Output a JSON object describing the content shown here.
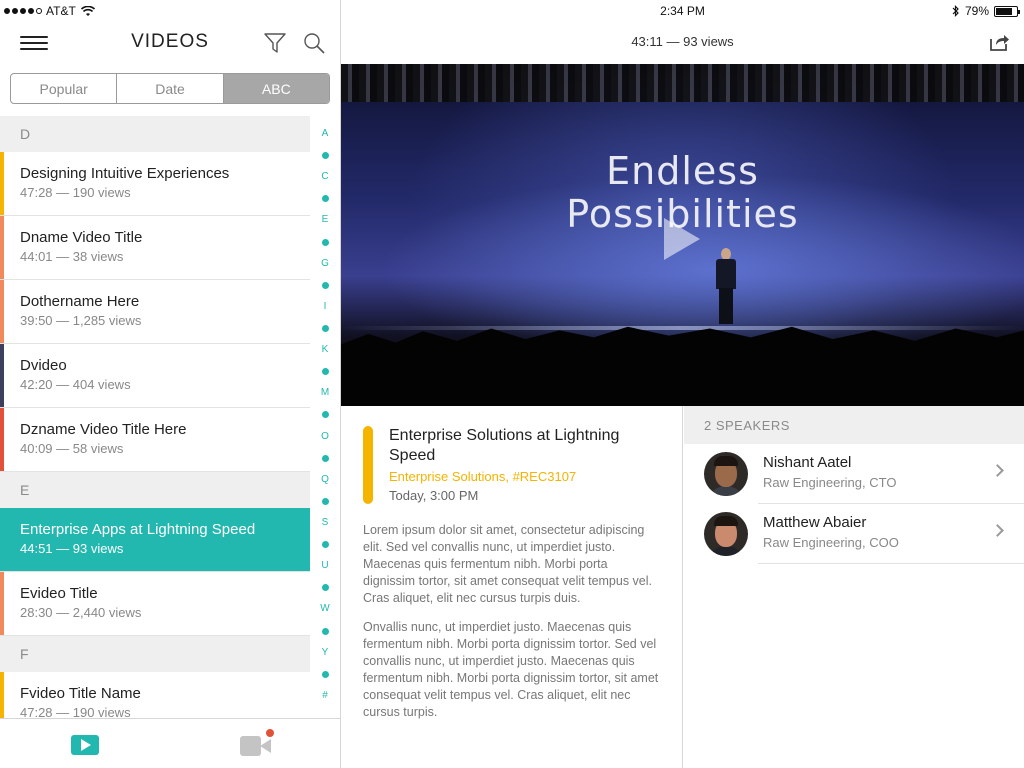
{
  "status": {
    "carrier": "AT&T",
    "time": "2:34 PM",
    "battery": "79%",
    "battery_level": 0.79
  },
  "left_header": {
    "title": "VIDEOS",
    "menu_icon": "hamburger-menu-icon",
    "filter_icon": "filter-icon",
    "search_icon": "search-icon"
  },
  "segments": {
    "items": [
      "Popular",
      "Date",
      "ABC"
    ],
    "selected": "ABC"
  },
  "sections": [
    {
      "letter": "D",
      "videos": [
        {
          "title": "Designing Intuitive Experiences",
          "meta": "47:28 — 190 views",
          "color": "#f4b400"
        },
        {
          "title": "Dname Video Title",
          "meta": "44:01 — 38 views",
          "color": "#f08a5d"
        },
        {
          "title": "Dothername Here",
          "meta": "39:50 — 1,285 views",
          "color": "#f08a5d"
        },
        {
          "title": "Dvideo",
          "meta": "42:20 — 404 views",
          "color": "#3d3f5e"
        },
        {
          "title": "Dzname Video Title Here",
          "meta": "40:09 — 58 views",
          "color": "#e0533a"
        }
      ]
    },
    {
      "letter": "E",
      "videos": [
        {
          "title": "Enterprise Apps at Lightning Speed",
          "meta": "44:51 — 93 views",
          "color": "#22b8af",
          "selected": true
        },
        {
          "title": "Evideo Title",
          "meta": "28:30 — 2,440 views",
          "color": "#f08a5d"
        }
      ]
    },
    {
      "letter": "F",
      "videos": [
        {
          "title": "Fvideo Title Name",
          "meta": "47:28 — 190 views",
          "color": "#f4b400"
        }
      ]
    }
  ],
  "index": [
    "A",
    "•",
    "C",
    "•",
    "E",
    "•",
    "G",
    "•",
    "I",
    "•",
    "K",
    "•",
    "M",
    "•",
    "O",
    "•",
    "Q",
    "•",
    "S",
    "•",
    "U",
    "•",
    "W",
    "•",
    "Y",
    "•",
    "#"
  ],
  "tabbar": {
    "videos_icon": "play-video-icon",
    "record_icon": "video-camera-icon"
  },
  "player": {
    "duration_views": "43:11 — 93 views",
    "share_icon": "share-icon",
    "slide_text_line1": "Endless",
    "slide_text_line2": "Possibilities"
  },
  "detail": {
    "title": "Enterprise Solutions at Lightning Speed",
    "tags": "Enterprise Solutions, #REC3107",
    "time": "Today, 3:00 PM",
    "paragraphs": [
      "Lorem ipsum dolor sit amet, consectetur adipiscing elit. Sed vel convallis nunc, ut imperdiet justo. Maecenas quis fermentum nibh. Morbi porta dignissim tortor, sit amet consequat velit tempus vel. Cras aliquet, elit nec cursus turpis duis.",
      "Onvallis nunc, ut imperdiet justo. Maecenas quis fermentum nibh. Morbi porta dignissim tortor. Sed vel convallis nunc, ut imperdiet justo. Maecenas quis fermentum nibh. Morbi porta dignissim tortor, sit amet consequat velit tempus vel. Cras aliquet, elit nec cursus turpis."
    ]
  },
  "speakers": {
    "header": "2 SPEAKERS",
    "items": [
      {
        "name": "Nishant Aatel",
        "role": "Raw Engineering, CTO",
        "skin": "#9b6a4b",
        "shirt": "#3a3e46"
      },
      {
        "name": "Matthew Abaier",
        "role": "Raw Engineering, COO",
        "skin": "#c98a6e",
        "shirt": "#1f2329"
      }
    ]
  },
  "colors": {
    "accent_teal": "#22b8af",
    "accent_yellow": "#f4b400"
  }
}
